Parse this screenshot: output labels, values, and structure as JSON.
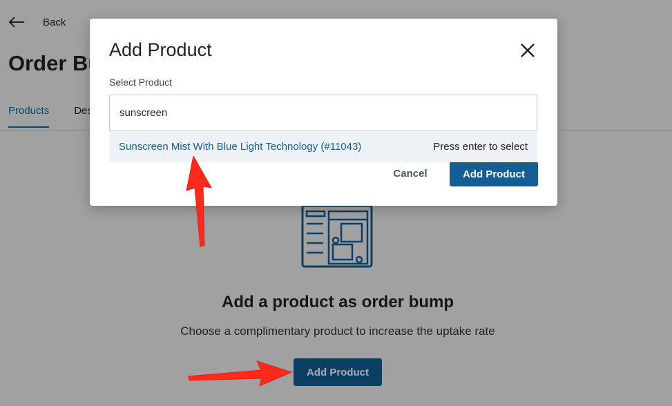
{
  "back": {
    "label": "Back"
  },
  "page": {
    "title": "Order Bump"
  },
  "tabs": [
    {
      "label": "Products"
    },
    {
      "label": "Design"
    }
  ],
  "empty_state": {
    "title": "Add a product as order bump",
    "subtitle": "Choose a complimentary product to increase the uptake rate",
    "button_label": "Add Product"
  },
  "modal": {
    "title": "Add Product",
    "field_label": "Select Product",
    "search_value": "sunscreen",
    "result_name": "Sunscreen Mist With Blue Light Technology (#11043)",
    "result_hint": "Press enter to select",
    "cancel_label": "Cancel",
    "add_label": "Add Product"
  },
  "colors": {
    "accent": "#135e96",
    "link": "#135e96",
    "annotation_arrow": "#ff2a1a"
  }
}
